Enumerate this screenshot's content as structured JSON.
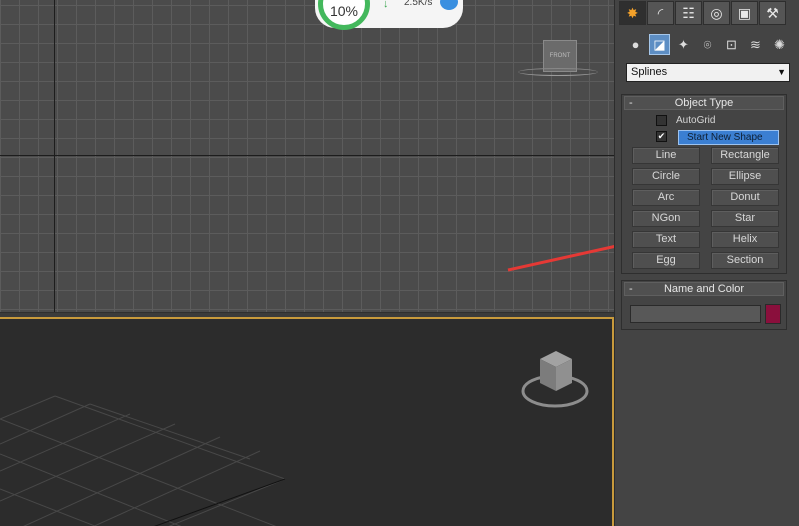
{
  "download": {
    "percent": "10%",
    "speed": "2.5K/s",
    "arrow_icon": "down-arrow-icon"
  },
  "viewport": {
    "viewcube_label": "FRONT"
  },
  "panel": {
    "tabs": [
      "create-icon",
      "modify-icon",
      "hierarchy-icon",
      "motion-icon",
      "display-icon",
      "utilities-icon"
    ],
    "category_dropdown": "Splines",
    "object_type": {
      "title": "Object Type",
      "collapse": "-",
      "autogrid_label": "AutoGrid",
      "start_new_shape_label": "Start New Shape",
      "buttons": [
        "Line",
        "Rectangle",
        "Circle",
        "Ellipse",
        "Arc",
        "Donut",
        "NGon",
        "Star",
        "Text",
        "Helix",
        "Egg",
        "Section"
      ]
    },
    "name_color": {
      "title": "Name and Color",
      "collapse": "-",
      "swatch_color": "#8a0f3c"
    }
  },
  "colors": {
    "accent_orange": "#f3a12a",
    "selection_blue": "#3b7fd2",
    "annotation_red": "#e53935",
    "viewport_border": "#c89a3c"
  }
}
